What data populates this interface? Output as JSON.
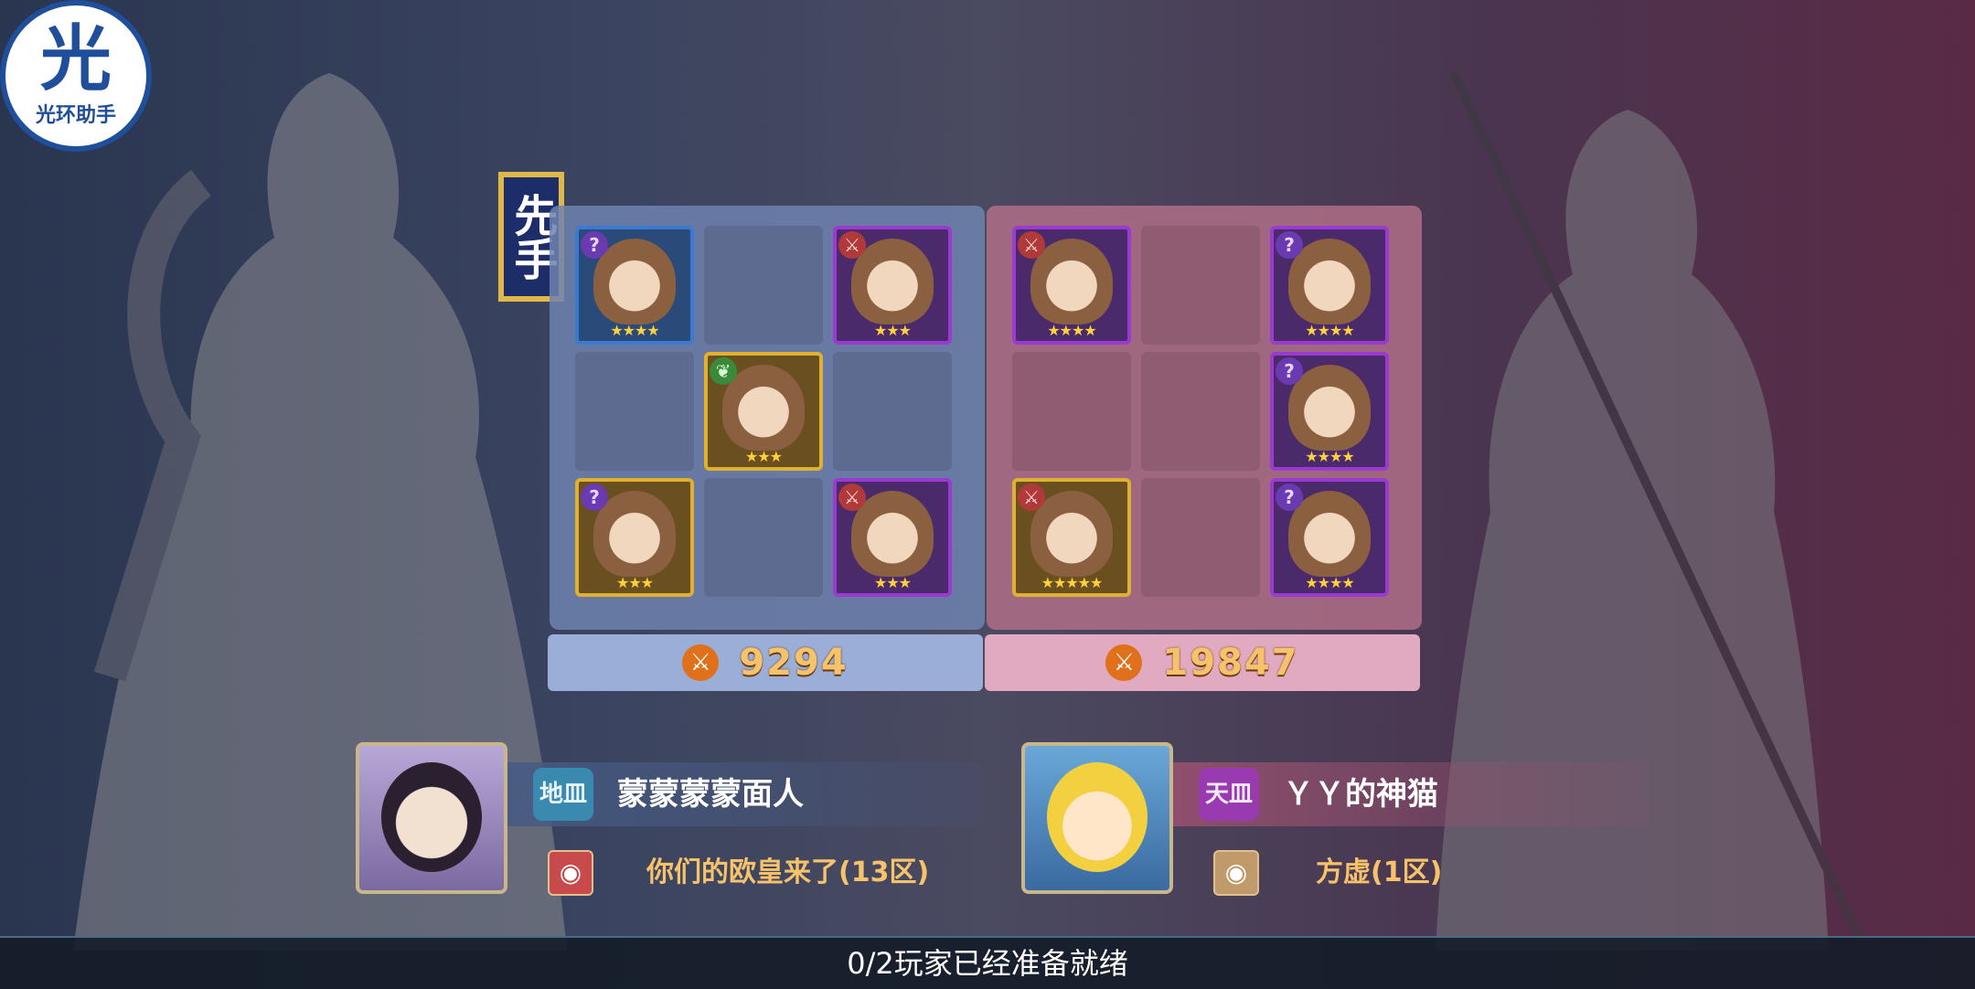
{
  "logo": {
    "glyph": "光",
    "caption": "光环助手"
  },
  "first_move_label": "先手",
  "left_team": {
    "power": "9294",
    "slots": [
      {
        "filled": true,
        "frame": "blue",
        "class_icon": "?",
        "class_color": "purple",
        "stars": "★★★★"
      },
      {
        "filled": false
      },
      {
        "filled": true,
        "frame": "purple",
        "class_icon": "⚔",
        "class_color": "red",
        "stars": "★★★"
      },
      {
        "filled": false
      },
      {
        "filled": true,
        "frame": "gold",
        "class_icon": "❦",
        "class_color": "green",
        "stars": "★★★"
      },
      {
        "filled": false
      },
      {
        "filled": true,
        "frame": "gold",
        "class_icon": "?",
        "class_color": "purple",
        "stars": "★★★"
      },
      {
        "filled": false
      },
      {
        "filled": true,
        "frame": "purple",
        "class_icon": "⚔",
        "class_color": "red",
        "stars": "★★★"
      }
    ]
  },
  "right_team": {
    "power": "19847",
    "slots": [
      {
        "filled": true,
        "frame": "purple",
        "class_icon": "⚔",
        "class_color": "red",
        "stars": "★★★★"
      },
      {
        "filled": false
      },
      {
        "filled": true,
        "frame": "purple",
        "class_icon": "?",
        "class_color": "purple",
        "stars": "★★★★"
      },
      {
        "filled": false
      },
      {
        "filled": false
      },
      {
        "filled": true,
        "frame": "purple",
        "class_icon": "?",
        "class_color": "purple",
        "stars": "★★★★"
      },
      {
        "filled": true,
        "frame": "gold",
        "class_icon": "⚔",
        "class_color": "red",
        "stars": "★★★★★"
      },
      {
        "filled": false
      },
      {
        "filled": true,
        "frame": "purple",
        "class_icon": "?",
        "class_color": "purple",
        "stars": "★★★★"
      }
    ]
  },
  "player_left": {
    "name": "蒙蒙蒙蒙面人",
    "rank_label": "地皿",
    "server": "你们的欧皇来了(13区)"
  },
  "player_right": {
    "name": "ＹＹ的神猫",
    "rank_label": "天皿",
    "server": "方虚(1区)"
  },
  "status_text": "0/2玩家已经准备就绪"
}
